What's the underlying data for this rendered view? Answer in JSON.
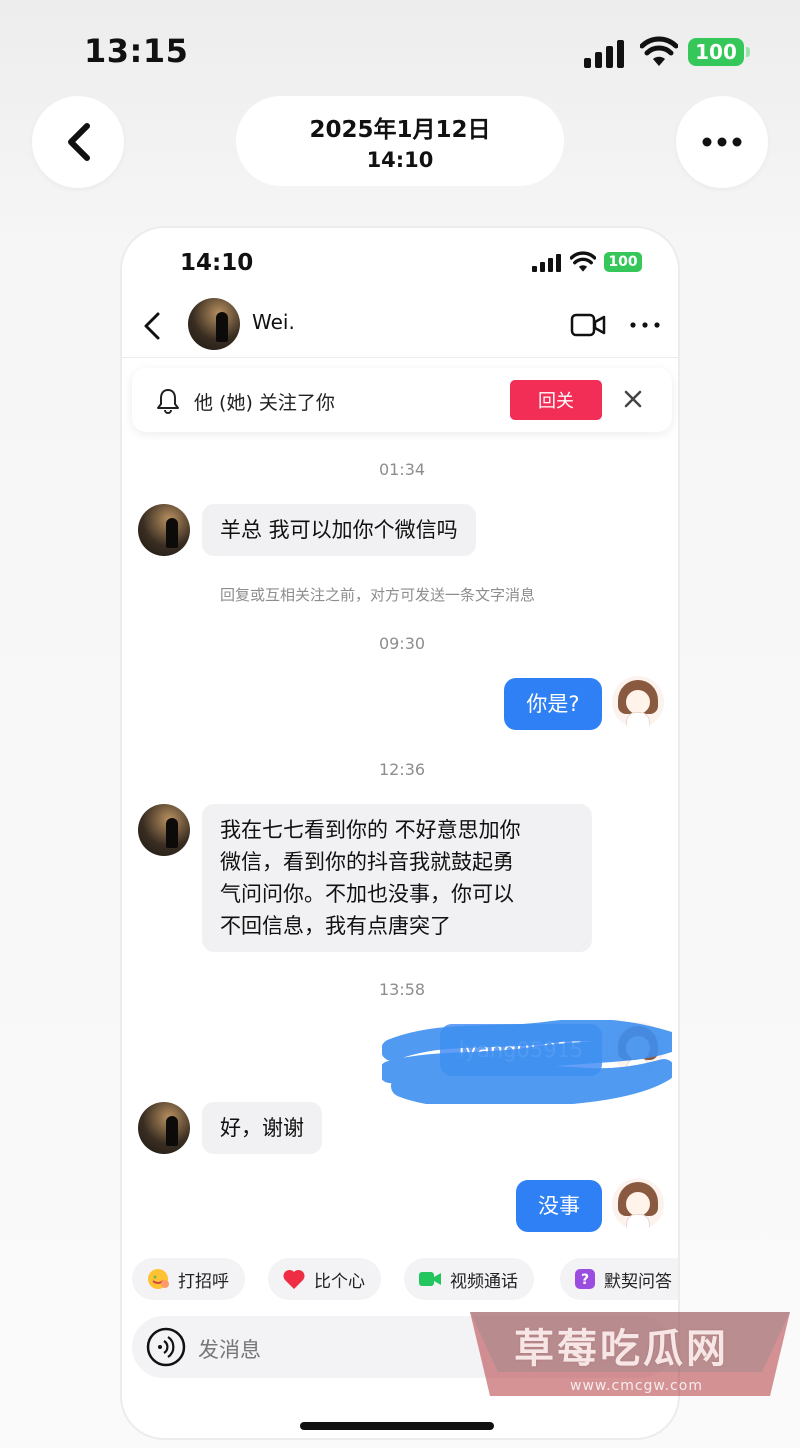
{
  "outer_status": {
    "time": "13:15",
    "battery": "100"
  },
  "viewer_header": {
    "date": "2025年1月12日",
    "time": "14:10"
  },
  "phone_status": {
    "time": "14:10",
    "battery": "100"
  },
  "chat": {
    "contact_name": "Wei.",
    "follow_notice": {
      "text": "他 (她) 关注了你",
      "button": "回关"
    },
    "messages": [
      {
        "timestamp": "01:34"
      },
      {
        "side": "left",
        "text": "羊总 我可以加你个微信吗"
      },
      {
        "notice": "回复或互相关注之前，对方可发送一条文字消息"
      },
      {
        "timestamp": "09:30"
      },
      {
        "side": "right",
        "text": "你是?"
      },
      {
        "timestamp": "12:36"
      },
      {
        "side": "left",
        "lines": [
          "我在七七看到你的 不好意思加你",
          "微信，看到你的抖音我就鼓起勇",
          "气问问你。不加也没事，你可以",
          "不回信息，我有点唐突了"
        ]
      },
      {
        "timestamp": "13:58"
      },
      {
        "side": "right",
        "text": "lyang05915",
        "redacted": true
      },
      {
        "side": "left",
        "text": "好，谢谢"
      },
      {
        "side": "right",
        "text": "没事"
      }
    ]
  },
  "quick_actions": [
    {
      "label": "打招呼",
      "icon": "wave-emoji-icon"
    },
    {
      "label": "比个心",
      "icon": "heart-icon"
    },
    {
      "label": "视频通话",
      "icon": "video-call-icon"
    },
    {
      "label": "默契问答",
      "icon": "question-icon"
    }
  ],
  "input": {
    "placeholder": "发消息"
  },
  "watermark": {
    "title": "草莓吃瓜网",
    "url": "www.cmcgw.com"
  },
  "colors": {
    "accent_blue": "#2f7ff5",
    "follow_red": "#f22e56",
    "battery_green": "#35c759"
  }
}
